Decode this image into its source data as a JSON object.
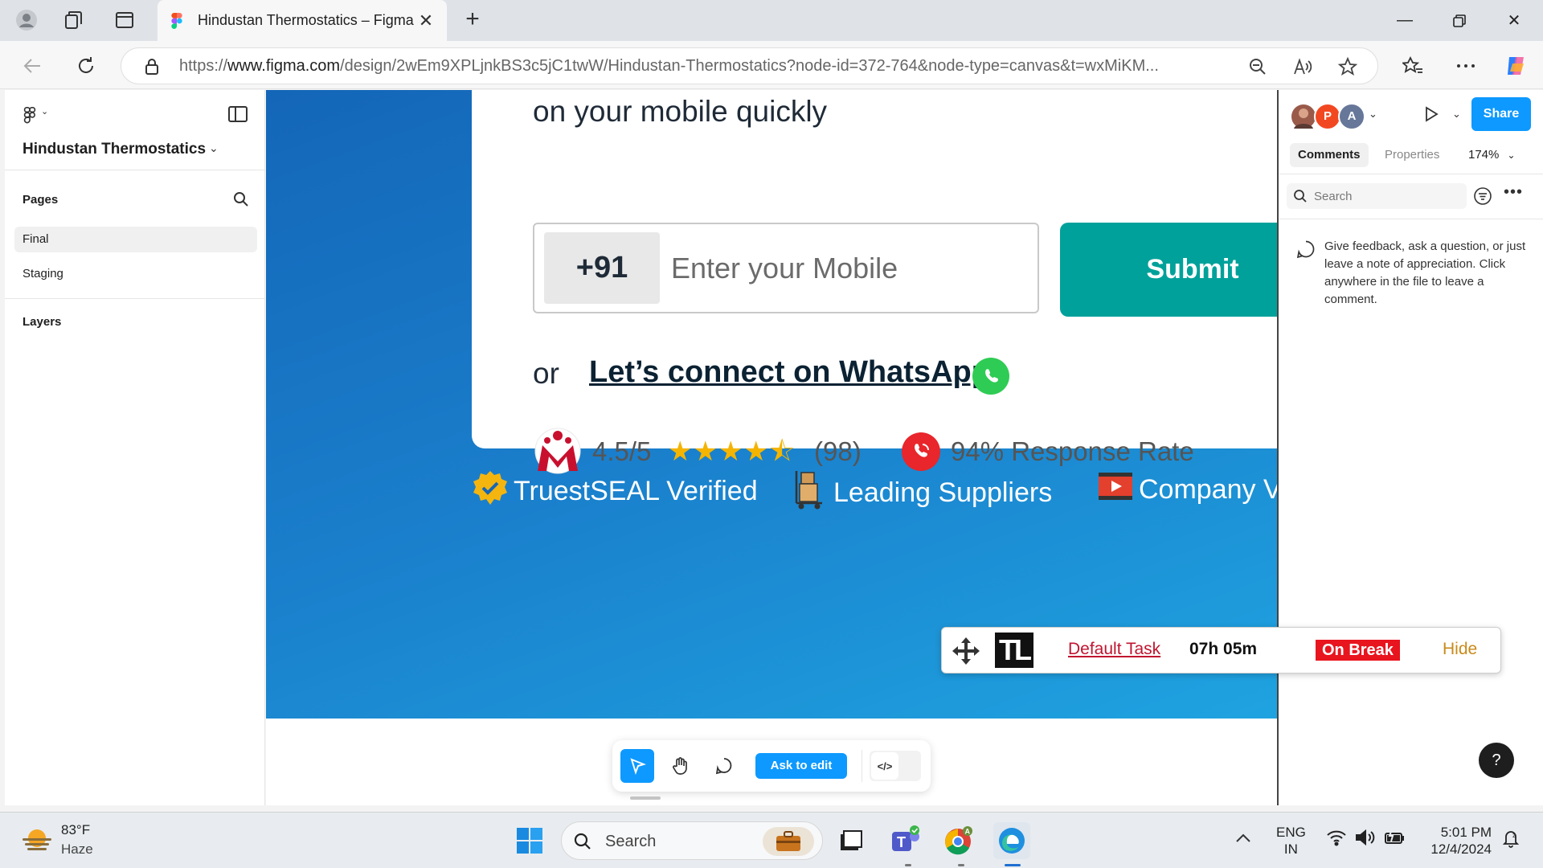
{
  "browser": {
    "tab_title": "Hindustan Thermostatics – Figma",
    "url_prefix": "https://",
    "url_domain": "www.figma.com",
    "url_path": "/design/2wEm9XPLjnkBS3c5jC1twW/Hindustan-Thermostatics?node-id=372-764&node-type=canvas&t=wxMiKM..."
  },
  "left_panel": {
    "project_name": "Hindustan Thermostatics",
    "pages_header": "Pages",
    "pages": [
      {
        "label": "Final",
        "active": true
      },
      {
        "label": "Staging",
        "active": false
      }
    ],
    "layers_header": "Layers"
  },
  "canvas": {
    "headline": "on your mobile quickly",
    "country_code": "+91",
    "mobile_placeholder": "Enter your Mobile",
    "submit_label": "Submit",
    "or_label": "or",
    "whatsapp_label": "Let’s connect on WhatsApp",
    "rating_value": "4.5/5",
    "stars": "★★★★",
    "half_star": "⯪",
    "rating_count": "(98)",
    "response_rate": "94% Response Rate",
    "features": [
      {
        "label": "TruestSEAL Verified",
        "icon": "verified-badge-icon"
      },
      {
        "label": "Leading Suppliers",
        "icon": "boxes-trolley-icon"
      },
      {
        "label": "Company V",
        "icon": "video-play-icon"
      }
    ],
    "colors": {
      "accent": "#00a19a",
      "gradient_start": "#1466b8",
      "gradient_end": "#1fa3e0"
    }
  },
  "bottom_toolbar": {
    "ask_to_edit_label": "Ask to edit",
    "dev_mode_label": "</>"
  },
  "right_panel": {
    "avatar_p": "P",
    "avatar_a": "A",
    "share_label": "Share",
    "tabs": [
      "Comments",
      "Properties"
    ],
    "zoom": "174%",
    "search_placeholder": "Search",
    "comment_hint": "Give feedback, ask a question, or just leave a note of appreciation. Click anywhere in the file to leave a comment.",
    "help_label": "?"
  },
  "tracker": {
    "logo": "TL",
    "task": "Default Task",
    "time": "07h 05m",
    "status": "On Break",
    "hide_label": "Hide"
  },
  "taskbar": {
    "temperature": "83°F",
    "condition": "Haze",
    "search_label": "Search",
    "lang_top": "ENG",
    "lang_bottom": "IN",
    "time": "5:01 PM",
    "date": "12/4/2024"
  }
}
